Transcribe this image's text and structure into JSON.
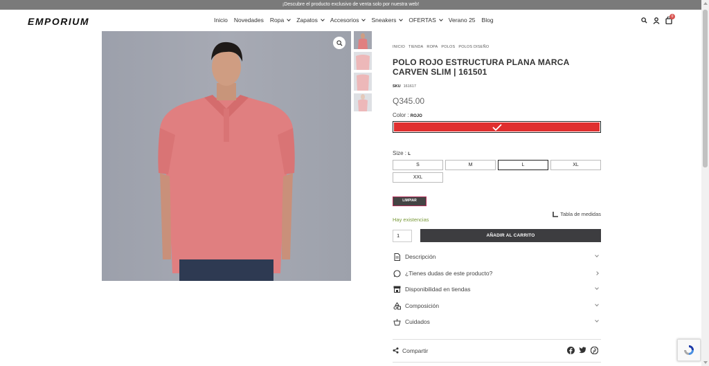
{
  "topbar": {
    "text": "¡Descubre el producto exclusivo de venta solo por nuestra web!"
  },
  "header": {
    "logo": "EMPORIUM",
    "nav": [
      {
        "label": "Inicio",
        "dropdown": false
      },
      {
        "label": "Novedades",
        "dropdown": false
      },
      {
        "label": "Ropa",
        "dropdown": true
      },
      {
        "label": "Zapatos",
        "dropdown": true
      },
      {
        "label": "Accesorios",
        "dropdown": true
      },
      {
        "label": "Sneakers",
        "dropdown": true
      },
      {
        "label": "OFERTAS",
        "dropdown": true
      },
      {
        "label": "Verano 25",
        "dropdown": false
      },
      {
        "label": "Blog",
        "dropdown": false
      }
    ],
    "cart_count": "0"
  },
  "breadcrumb": [
    "INICIO",
    "TIENDA",
    "ROPA",
    "POLOS",
    "POLOS DISEÑO"
  ],
  "product": {
    "title": "POLO ROJO ESTRUCTURA PLANA MARCA CARVEN SLIM | 161501",
    "sku_label": "SKU",
    "sku": "161617",
    "price": "Q345.00",
    "color_label": "Color :",
    "color_value": "ROJO",
    "color_hex": "#e02f2f",
    "size_label": "Size :",
    "size_value": "L",
    "sizes": [
      "S",
      "M",
      "L",
      "XL",
      "XXL"
    ],
    "selected_size": "L",
    "clear_label": "LIMPIAR",
    "size_chart": "Tabla de medidas",
    "stock": "Hay existencias",
    "qty": "1",
    "add_to_cart": "AÑADIR AL CARRITO"
  },
  "accordion": [
    {
      "label": "Descripción",
      "icon": "document-icon"
    },
    {
      "label": "¿Tienes dudas de este producto?",
      "icon": "whatsapp-icon"
    },
    {
      "label": "Disponibilidad en tiendas",
      "icon": "store-icon"
    },
    {
      "label": "Composición",
      "icon": "shapes-icon"
    },
    {
      "label": "Cuidados",
      "icon": "care-icon"
    }
  ],
  "share": {
    "label": "Compartir"
  },
  "colors": {
    "shirt": "#e07f80",
    "accent": "#b3305a",
    "button": "#3d3d40"
  }
}
